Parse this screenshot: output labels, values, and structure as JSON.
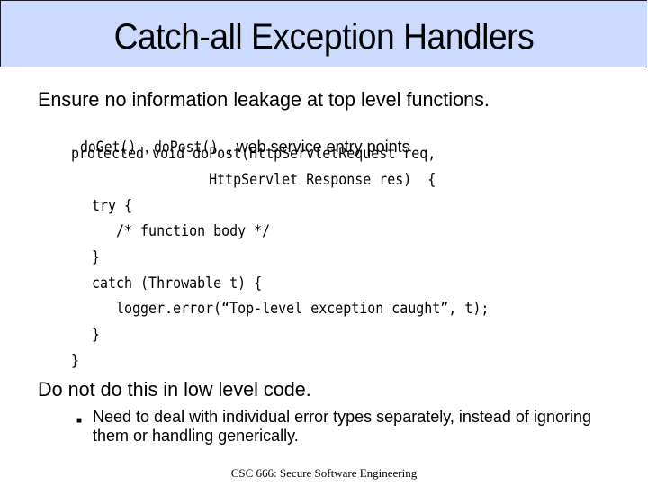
{
  "slide": {
    "title": "Catch-all Exception Handlers",
    "bullet1": "Ensure no information leakage at top level functions.",
    "sub1": {
      "code_a": "doGet()",
      "sep_a": ", ",
      "code_b": "doPost()",
      "text": ", web service entry points"
    },
    "code_lines": [
      "protected void doPost(HttpServletRequest req,",
      "                 HttpServlet Response res)  {",
      "  try {",
      "     /* function body */",
      "  }",
      "  catch (Throwable t) {",
      "     logger.error(“Top-level exception caught”, t);",
      "  }",
      "}"
    ],
    "bullet2": "Do not do this in low level code.",
    "sub2_marker": "■",
    "sub2": "Need to deal with individual error types separately, instead of ignoring them or handling generically.",
    "footer": "CSC 666: Secure Software Engineering"
  },
  "colors": {
    "title_bg": "#ccdafd",
    "title_border": "#1a1a2a"
  }
}
